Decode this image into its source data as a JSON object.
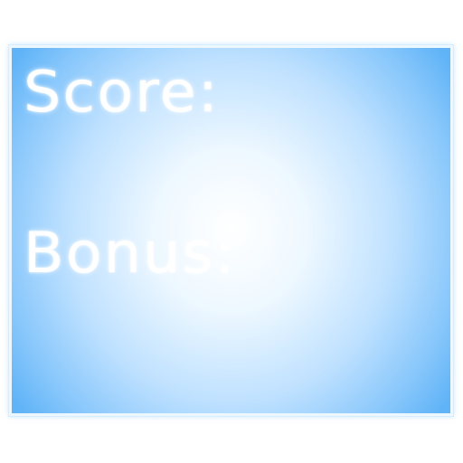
{
  "hud": {
    "score_label": "Score:",
    "bonus_label": "Bonus:"
  },
  "colors": {
    "panel_center": "#ffffff",
    "panel_edge": "#5fb3f7",
    "border": "#ecf7ff",
    "text": "#ffffff"
  }
}
